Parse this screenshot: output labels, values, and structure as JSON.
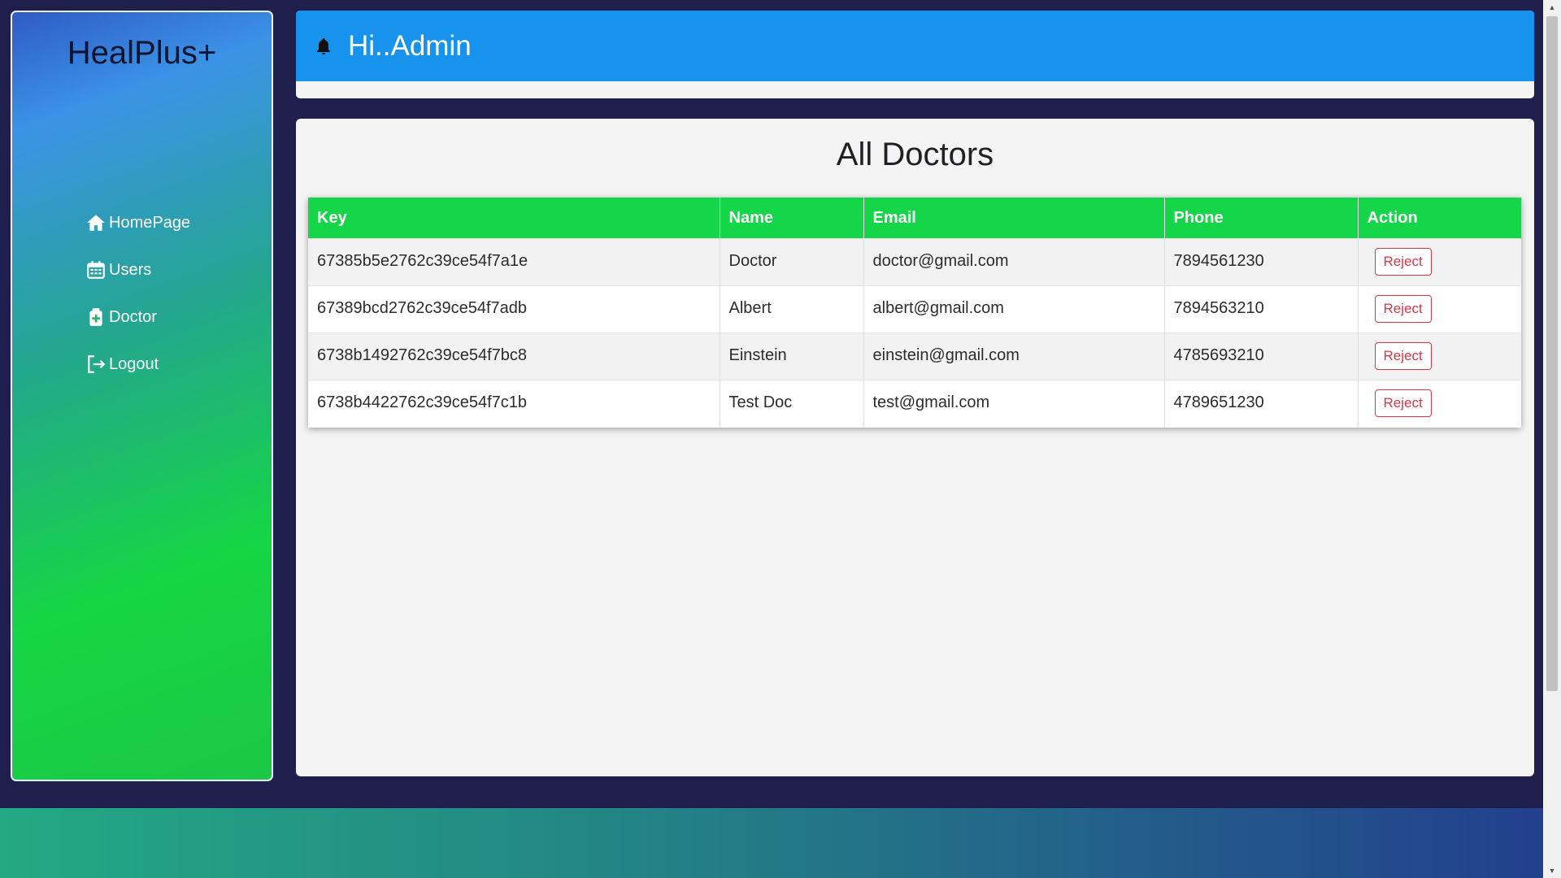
{
  "sidebar": {
    "brand": "HealPlus+",
    "items": [
      {
        "label": "HomePage",
        "icon": "home-icon"
      },
      {
        "label": "Users",
        "icon": "calendar-icon"
      },
      {
        "label": "Doctor",
        "icon": "medical-bag-icon"
      },
      {
        "label": "Logout",
        "icon": "logout-icon"
      }
    ]
  },
  "header": {
    "greeting": "Hi..Admin",
    "icon": "bell-icon"
  },
  "main": {
    "title": "All Doctors",
    "table": {
      "columns": [
        "Key",
        "Name",
        "Email",
        "Phone",
        "Action"
      ],
      "rows": [
        {
          "key": "67385b5e2762c39ce54f7a1e",
          "name": "Doctor",
          "email": "doctor@gmail.com",
          "phone": "7894561230",
          "action": "Reject"
        },
        {
          "key": "67389bcd2762c39ce54f7adb",
          "name": "Albert",
          "email": "albert@gmail.com",
          "phone": "7894563210",
          "action": "Reject"
        },
        {
          "key": "6738b1492762c39ce54f7bc8",
          "name": "Einstein",
          "email": "einstein@gmail.com",
          "phone": "4785693210",
          "action": "Reject"
        },
        {
          "key": "6738b4422762c39ce54f7c1b",
          "name": "Test Doc",
          "email": "test@gmail.com",
          "phone": "4789651230",
          "action": "Reject"
        }
      ]
    }
  },
  "colors": {
    "header_blue": "#1793ee",
    "table_header_green": "#15d648",
    "reject_red": "#dc3545",
    "page_background": "#1f1f4d"
  }
}
